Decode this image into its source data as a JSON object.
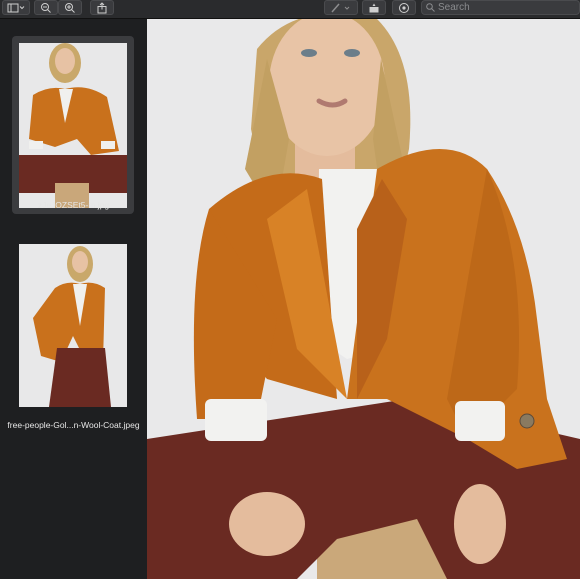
{
  "toolbar": {
    "buttons": [
      {
        "name": "sidebar-toggle-button",
        "icon": "sidebar-icon"
      },
      {
        "name": "zoom-out-button",
        "icon": "zoom-out-icon"
      },
      {
        "name": "zoom-in-button",
        "icon": "zoom-in-icon"
      },
      {
        "name": "share-button",
        "icon": "share-icon"
      },
      {
        "name": "markup-button",
        "icon": "pen-icon"
      },
      {
        "name": "rotate-button",
        "icon": "rotate-icon"
      },
      {
        "name": "annotate-button",
        "icon": "markup-circle-icon"
      }
    ],
    "search_placeholder": "Search"
  },
  "sidebar": {
    "thumbnails": [
      {
        "filename": "zJeJOZSEt5-m.jpg",
        "selected": true
      },
      {
        "filename": "free-people-Gol...n-Wool-Coat.jpeg",
        "selected": false
      }
    ]
  },
  "colors": {
    "coat": "#c8711c",
    "pants": "#6a2a22",
    "shirt": "#f2f2f0",
    "background": "#e9e9ea",
    "chrome": "#1e1f21"
  }
}
